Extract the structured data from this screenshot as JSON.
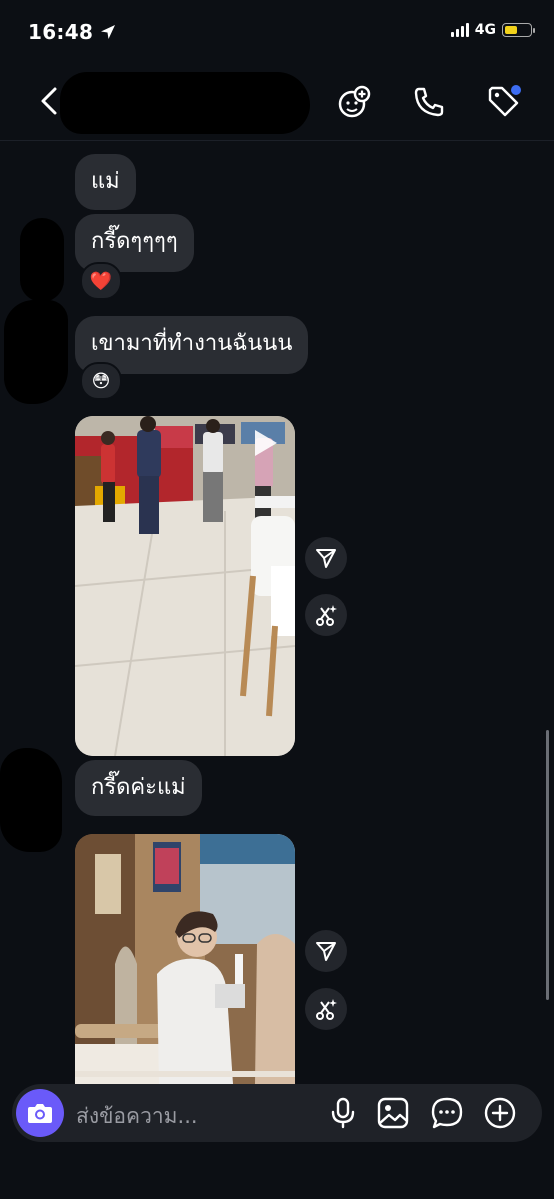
{
  "status_bar": {
    "time": "16:48",
    "network": "4G",
    "battery_color": "#f2d21b",
    "location_icon": "location-arrow-icon"
  },
  "header": {
    "contact_name_redacted": true,
    "icons": [
      "back-chevron-icon",
      "add-to-group-icon",
      "phone-icon",
      "tag-icon"
    ],
    "tag_dot_color": "#3d6df2"
  },
  "messages": [
    {
      "id": "m1",
      "type": "text",
      "text": "แม่"
    },
    {
      "id": "m2",
      "type": "text",
      "text": "กรี๊ดๆๆๆๆ",
      "reaction": "❤️"
    },
    {
      "id": "m3",
      "type": "text",
      "text": "เขามาที่ทำงานฉันนน",
      "reaction": "😳"
    },
    {
      "id": "m4",
      "type": "video",
      "content": "mall-walkway-video"
    },
    {
      "id": "m5",
      "type": "text",
      "text": "กรี๊ดค่ะแม่"
    },
    {
      "id": "m6",
      "type": "video",
      "content": "cafe-man-video"
    }
  ],
  "media_actions": [
    "share-icon",
    "ai-sparkle-icon"
  ],
  "composer": {
    "placeholder": "ส่งข้อความ...",
    "icons": [
      "camera-icon",
      "microphone-icon",
      "gallery-icon",
      "sticker-message-icon",
      "plus-icon"
    ],
    "camera_color": "#6a5af9"
  },
  "colors": {
    "background": "#0c0f14",
    "bubble": "#2a2d33"
  }
}
